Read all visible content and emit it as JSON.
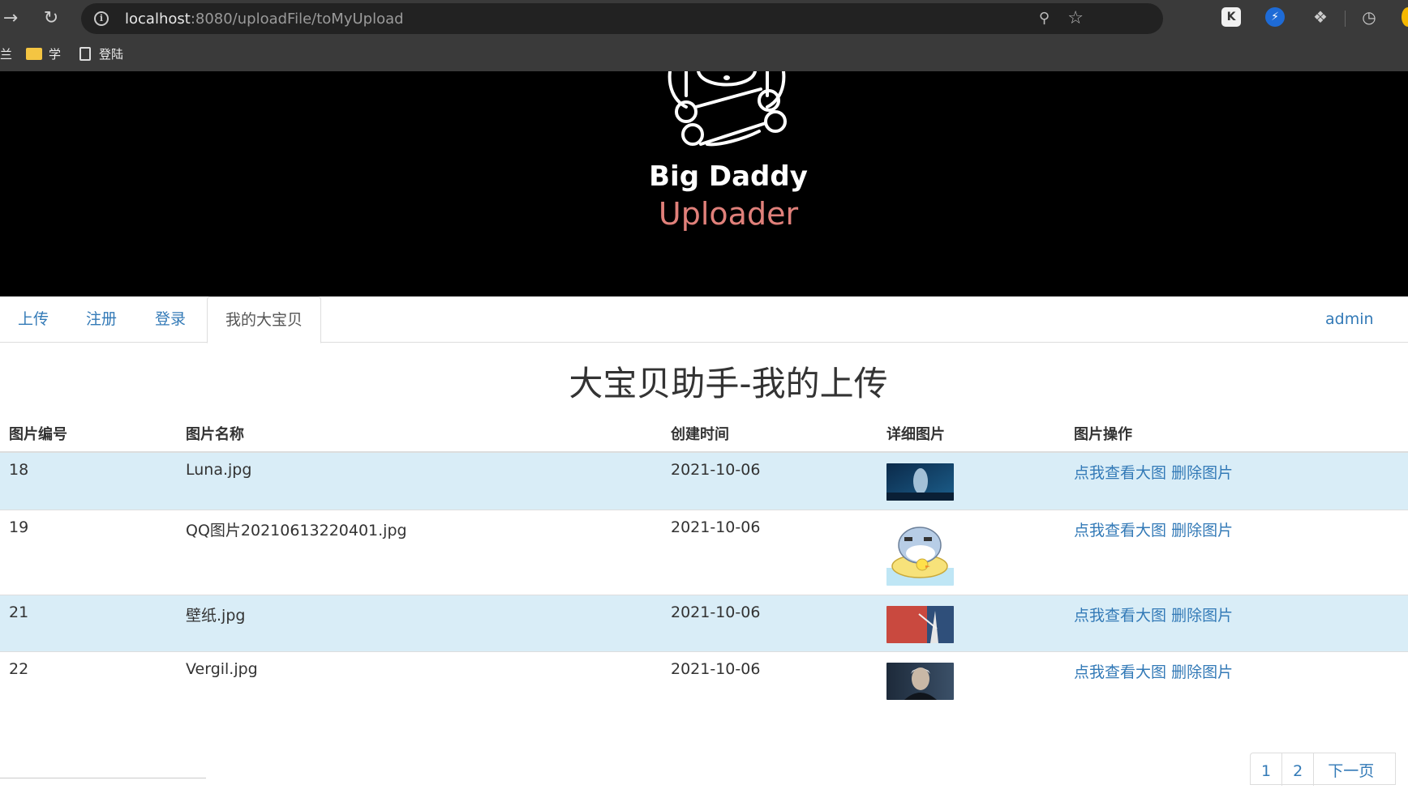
{
  "browser": {
    "url_host": "localhost",
    "url_rest": ":8080/uploadFile/toMyUpload",
    "bookmarks": [
      {
        "label": "学",
        "icon": "folder-icon"
      },
      {
        "label": "登陆",
        "icon": "page-icon"
      }
    ],
    "bookmarks_prefix": "兰"
  },
  "banner": {
    "title": "Big Daddy",
    "subtitle": "Uploader",
    "subtitle_color": "#e0807a"
  },
  "nav": {
    "tabs": [
      {
        "label": "上传"
      },
      {
        "label": "注册"
      },
      {
        "label": "登录"
      },
      {
        "label": "我的大宝贝",
        "active": true
      }
    ],
    "user": "admin"
  },
  "page": {
    "heading": "大宝贝助手-我的上传"
  },
  "table": {
    "columns": [
      "图片编号",
      "图片名称",
      "创建时间",
      "详细图片",
      "图片操作"
    ],
    "rows": [
      {
        "id": "18",
        "name": "Luna.jpg",
        "created": "2021-10-06",
        "view": "点我查看大图",
        "delete": "删除图片"
      },
      {
        "id": "19",
        "name": "QQ图片20210613220401.jpg",
        "created": "2021-10-06",
        "view": "点我查看大图",
        "delete": "删除图片"
      },
      {
        "id": "21",
        "name": "壁纸.jpg",
        "created": "2021-10-06",
        "view": "点我查看大图",
        "delete": "删除图片"
      },
      {
        "id": "22",
        "name": "Vergil.jpg",
        "created": "2021-10-06",
        "view": "点我查看大图",
        "delete": "删除图片"
      }
    ]
  },
  "pagination": {
    "pages": [
      "1",
      "2"
    ],
    "next": "下一页"
  },
  "colors": {
    "link": "#337ab7",
    "row_stripe": "#d9edf7",
    "banner_bg": "#000000"
  }
}
